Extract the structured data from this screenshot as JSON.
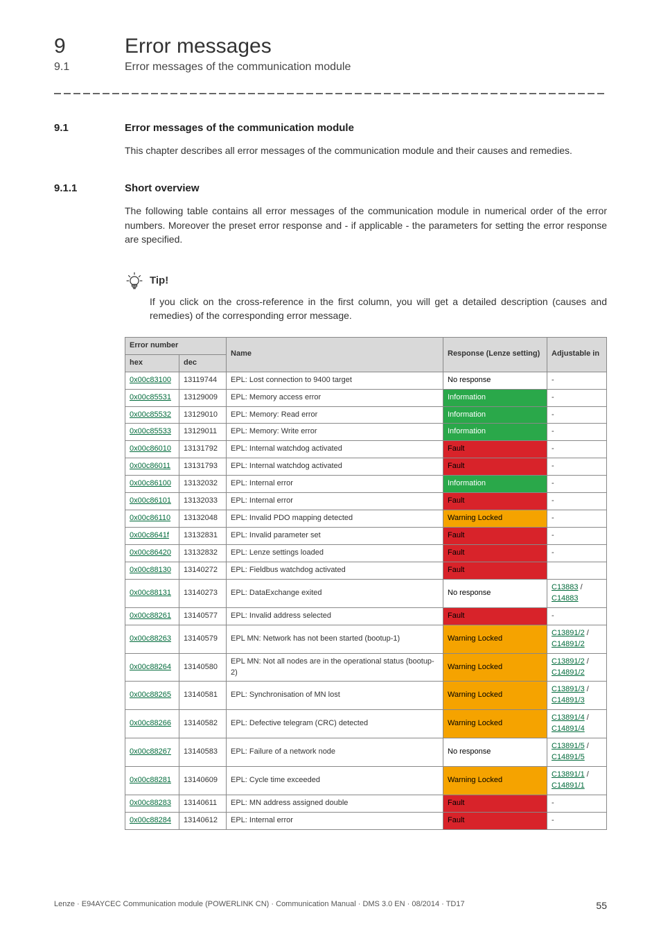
{
  "header": {
    "chapter_num": "9",
    "chapter_title": "Error messages",
    "section_num": "9.1",
    "section_title": "Error messages of the communication module"
  },
  "s91": {
    "num": "9.1",
    "title": "Error messages of the communication module",
    "para": "This chapter describes all error messages of the communication module and their causes and remedies."
  },
  "s911": {
    "num": "9.1.1",
    "title": "Short overview",
    "para": "The following table contains all error messages of the communication module in numerical order of the error numbers. Moreover the preset error response and - if applicable - the parameters for setting the error response are specified."
  },
  "tip": {
    "label": "Tip!",
    "text": "If you click on the cross-reference in the first column, you will get a detailed description (causes and remedies) of the corresponding error message."
  },
  "table": {
    "head": {
      "errnum": "Error number",
      "name": "Name",
      "resp": "Response (Lenze setting)",
      "adj": "Adjustable in",
      "hex": "hex",
      "dec": "dec"
    },
    "rows": [
      {
        "hex": "0x00c83100",
        "dec": "13119744",
        "name": "EPL: Lost connection to 9400 target",
        "resp": "No response",
        "resp_cls": "resp-none",
        "adj": "-"
      },
      {
        "hex": "0x00c85531",
        "dec": "13129009",
        "name": "EPL: Memory access error",
        "resp": "Information",
        "resp_cls": "resp-info",
        "adj": "-"
      },
      {
        "hex": "0x00c85532",
        "dec": "13129010",
        "name": "EPL: Memory: Read error",
        "resp": "Information",
        "resp_cls": "resp-info",
        "adj": "-"
      },
      {
        "hex": "0x00c85533",
        "dec": "13129011",
        "name": "EPL: Memory: Write error",
        "resp": "Information",
        "resp_cls": "resp-info",
        "adj": "-"
      },
      {
        "hex": "0x00c86010",
        "dec": "13131792",
        "name": "EPL: Internal watchdog activated",
        "resp": "Fault",
        "resp_cls": "resp-fault",
        "adj": "-"
      },
      {
        "hex": "0x00c86011",
        "dec": "13131793",
        "name": "EPL: Internal watchdog activated",
        "resp": "Fault",
        "resp_cls": "resp-fault",
        "adj": "-"
      },
      {
        "hex": "0x00c86100",
        "dec": "13132032",
        "name": "EPL: Internal error",
        "resp": "Information",
        "resp_cls": "resp-info",
        "adj": "-"
      },
      {
        "hex": "0x00c86101",
        "dec": "13132033",
        "name": "EPL: Internal error",
        "resp": "Fault",
        "resp_cls": "resp-fault",
        "adj": "-"
      },
      {
        "hex": "0x00c86110",
        "dec": "13132048",
        "name": "EPL: Invalid PDO mapping detected",
        "resp": "Warning Locked",
        "resp_cls": "resp-warn",
        "adj": "-"
      },
      {
        "hex": "0x00c8641f",
        "dec": "13132831",
        "name": "EPL: Invalid parameter set",
        "resp": "Fault",
        "resp_cls": "resp-fault",
        "adj": "-"
      },
      {
        "hex": "0x00c86420",
        "dec": "13132832",
        "name": "EPL: Lenze settings loaded",
        "resp": "Fault",
        "resp_cls": "resp-fault",
        "adj": "-"
      },
      {
        "hex": "0x00c88130",
        "dec": "13140272",
        "name": "EPL: Fieldbus watchdog activated",
        "resp": "Fault",
        "resp_cls": "resp-fault",
        "adj": ""
      },
      {
        "hex": "0x00c88131",
        "dec": "13140273",
        "name": "EPL: DataExchange exited",
        "resp": "No response",
        "resp_cls": "resp-none",
        "adj_links": [
          "C13883",
          "C14883"
        ]
      },
      {
        "hex": "0x00c88261",
        "dec": "13140577",
        "name": "EPL: Invalid address selected",
        "resp": "Fault",
        "resp_cls": "resp-fault",
        "adj": "-"
      },
      {
        "hex": "0x00c88263",
        "dec": "13140579",
        "name": "EPL MN: Network has not been started (bootup-1)",
        "resp": "Warning Locked",
        "resp_cls": "resp-warn",
        "adj_links": [
          "C13891/2",
          "C14891/2"
        ]
      },
      {
        "hex": "0x00c88264",
        "dec": "13140580",
        "name": "EPL MN: Not all nodes are in the operational status (bootup-2)",
        "resp": "Warning Locked",
        "resp_cls": "resp-warn",
        "adj_links": [
          "C13891/2",
          "C14891/2"
        ]
      },
      {
        "hex": "0x00c88265",
        "dec": "13140581",
        "name": "EPL: Synchronisation of MN lost",
        "resp": "Warning Locked",
        "resp_cls": "resp-warn",
        "adj_links": [
          "C13891/3",
          "C14891/3"
        ]
      },
      {
        "hex": "0x00c88266",
        "dec": "13140582",
        "name": "EPL: Defective telegram (CRC) detected",
        "resp": "Warning Locked",
        "resp_cls": "resp-warn",
        "adj_links": [
          "C13891/4",
          "C14891/4"
        ]
      },
      {
        "hex": "0x00c88267",
        "dec": "13140583",
        "name": "EPL: Failure of a network node",
        "resp": "No response",
        "resp_cls": "resp-none",
        "adj_links": [
          "C13891/5",
          "C14891/5"
        ]
      },
      {
        "hex": "0x00c88281",
        "dec": "13140609",
        "name": "EPL: Cycle time exceeded",
        "resp": "Warning Locked",
        "resp_cls": "resp-warn",
        "adj_links": [
          "C13891/1",
          "C14891/1"
        ]
      },
      {
        "hex": "0x00c88283",
        "dec": "13140611",
        "name": "EPL: MN address assigned double",
        "resp": "Fault",
        "resp_cls": "resp-fault",
        "adj": "-"
      },
      {
        "hex": "0x00c88284",
        "dec": "13140612",
        "name": "EPL: Internal error",
        "resp": "Fault",
        "resp_cls": "resp-fault",
        "adj": "-"
      }
    ]
  },
  "footer": {
    "left": "Lenze · E94AYCEC Communication module (POWERLINK CN) · Communication Manual · DMS 3.0 EN · 08/2014 · TD17",
    "page": "55"
  }
}
